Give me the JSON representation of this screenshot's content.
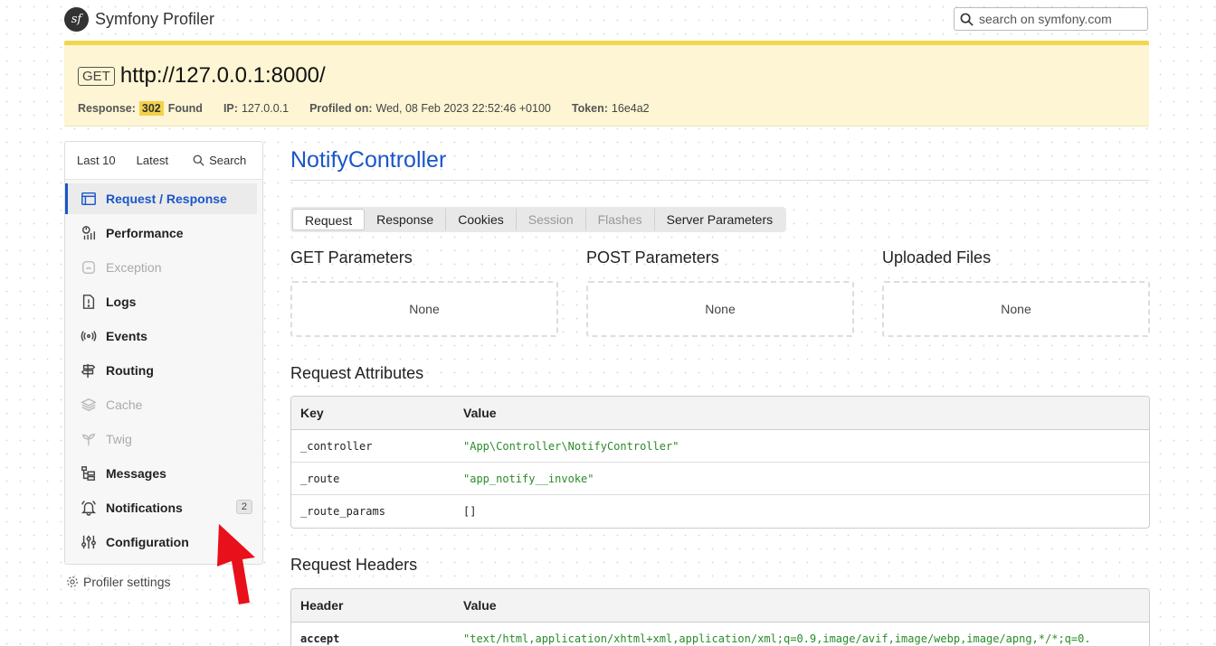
{
  "header": {
    "logo_mark": "sf",
    "app_title": "Symfony Profiler",
    "search_placeholder": "search on symfony.com"
  },
  "summary": {
    "method": "GET",
    "url": "http://127.0.0.1:8000/",
    "response_label": "Response:",
    "status_code": "302",
    "status_text": "Found",
    "ip_label": "IP:",
    "ip": "127.0.0.1",
    "profiled_label": "Profiled on:",
    "profiled_on": "Wed, 08 Feb 2023 22:52:46 +0100",
    "token_label": "Token:",
    "token": "16e4a2",
    "accent_color": "#f2d64e"
  },
  "sidebar": {
    "top": {
      "last10": "Last 10",
      "latest": "Latest",
      "search": "Search"
    },
    "items": [
      {
        "label": "Request / Response",
        "icon": "request-icon",
        "state": "active"
      },
      {
        "label": "Performance",
        "icon": "performance-icon",
        "state": "normal"
      },
      {
        "label": "Exception",
        "icon": "exception-icon",
        "state": "disabled"
      },
      {
        "label": "Logs",
        "icon": "logs-icon",
        "state": "normal"
      },
      {
        "label": "Events",
        "icon": "events-icon",
        "state": "normal"
      },
      {
        "label": "Routing",
        "icon": "routing-icon",
        "state": "normal"
      },
      {
        "label": "Cache",
        "icon": "cache-icon",
        "state": "disabled"
      },
      {
        "label": "Twig",
        "icon": "twig-icon",
        "state": "disabled"
      },
      {
        "label": "Messages",
        "icon": "messages-icon",
        "state": "normal"
      },
      {
        "label": "Notifications",
        "icon": "bell-icon",
        "state": "normal",
        "badge": "2"
      },
      {
        "label": "Configuration",
        "icon": "sliders-icon",
        "state": "normal"
      }
    ],
    "settings_label": "Profiler settings"
  },
  "main": {
    "title": "NotifyController",
    "tabs": [
      {
        "label": "Request",
        "state": "active"
      },
      {
        "label": "Response",
        "state": "normal"
      },
      {
        "label": "Cookies",
        "state": "normal"
      },
      {
        "label": "Session",
        "state": "disabled"
      },
      {
        "label": "Flashes",
        "state": "disabled"
      },
      {
        "label": "Server Parameters",
        "state": "normal"
      }
    ],
    "get_params": {
      "heading": "GET Parameters",
      "empty": "None"
    },
    "post_params": {
      "heading": "POST Parameters",
      "empty": "None"
    },
    "uploaded_files": {
      "heading": "Uploaded Files",
      "empty": "None"
    },
    "attributes": {
      "heading": "Request Attributes",
      "columns": [
        "Key",
        "Value"
      ],
      "rows": [
        {
          "key": "_controller",
          "value": "\"App\\Controller\\NotifyController\""
        },
        {
          "key": "_route",
          "value": "\"app_notify__invoke\""
        },
        {
          "key": "_route_params",
          "value": "[]"
        }
      ]
    },
    "headers": {
      "heading": "Request Headers",
      "columns": [
        "Header",
        "Value"
      ],
      "rows": [
        {
          "key": "accept",
          "value": "\"text/html,application/xhtml+xml,application/xml;q=0.9,image/avif,image/webp,image/apng,*/*;q=0."
        }
      ]
    }
  },
  "colors": {
    "link_blue": "#1a56c9",
    "string_green": "#2a8a2a",
    "annotation_red": "#e8101a"
  }
}
